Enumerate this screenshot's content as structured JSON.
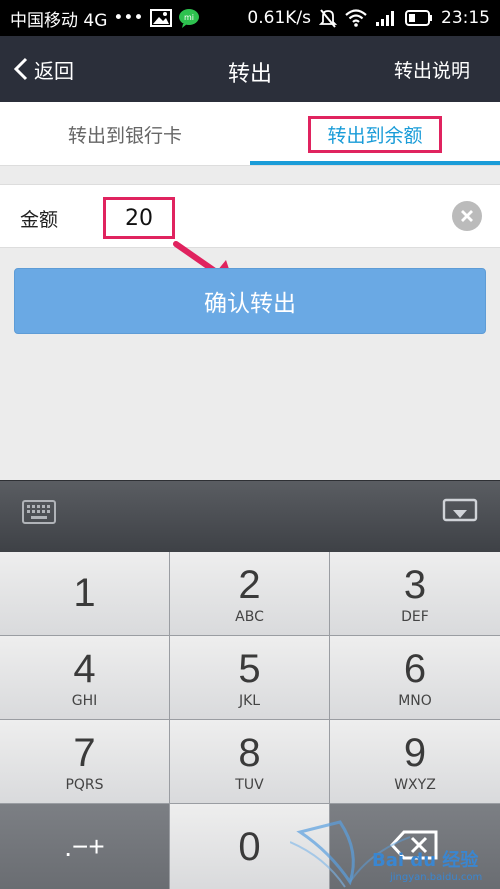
{
  "statusbar": {
    "carrier": "中国移动 4G",
    "dots": "•••",
    "speed": "0.61K/s",
    "time": "23:15"
  },
  "navbar": {
    "back_label": "返回",
    "title": "转出",
    "help_label": "转出说明"
  },
  "tabs": [
    {
      "label": "转出到银行卡",
      "active": false
    },
    {
      "label": "转出到余额",
      "active": true
    }
  ],
  "form": {
    "amount_label": "金额",
    "amount_value": "20",
    "confirm_label": "确认转出"
  },
  "keypad": {
    "keys": [
      {
        "num": "1",
        "letters": ""
      },
      {
        "num": "2",
        "letters": "ABC"
      },
      {
        "num": "3",
        "letters": "DEF"
      },
      {
        "num": "4",
        "letters": "GHI"
      },
      {
        "num": "5",
        "letters": "JKL"
      },
      {
        "num": "6",
        "letters": "MNO"
      },
      {
        "num": "7",
        "letters": "PQRS"
      },
      {
        "num": "8",
        "letters": "TUV"
      },
      {
        "num": "9",
        "letters": "WXYZ"
      }
    ],
    "symbols_label": ".−+",
    "zero_label": "0"
  },
  "watermark": {
    "text": "Bai du 经验",
    "url": "jingyan.baidu.com"
  },
  "colors": {
    "accent": "#1a9cd8",
    "highlight": "#e0235f",
    "button": "#6aa9e4",
    "navbar": "#2b2f3a"
  }
}
